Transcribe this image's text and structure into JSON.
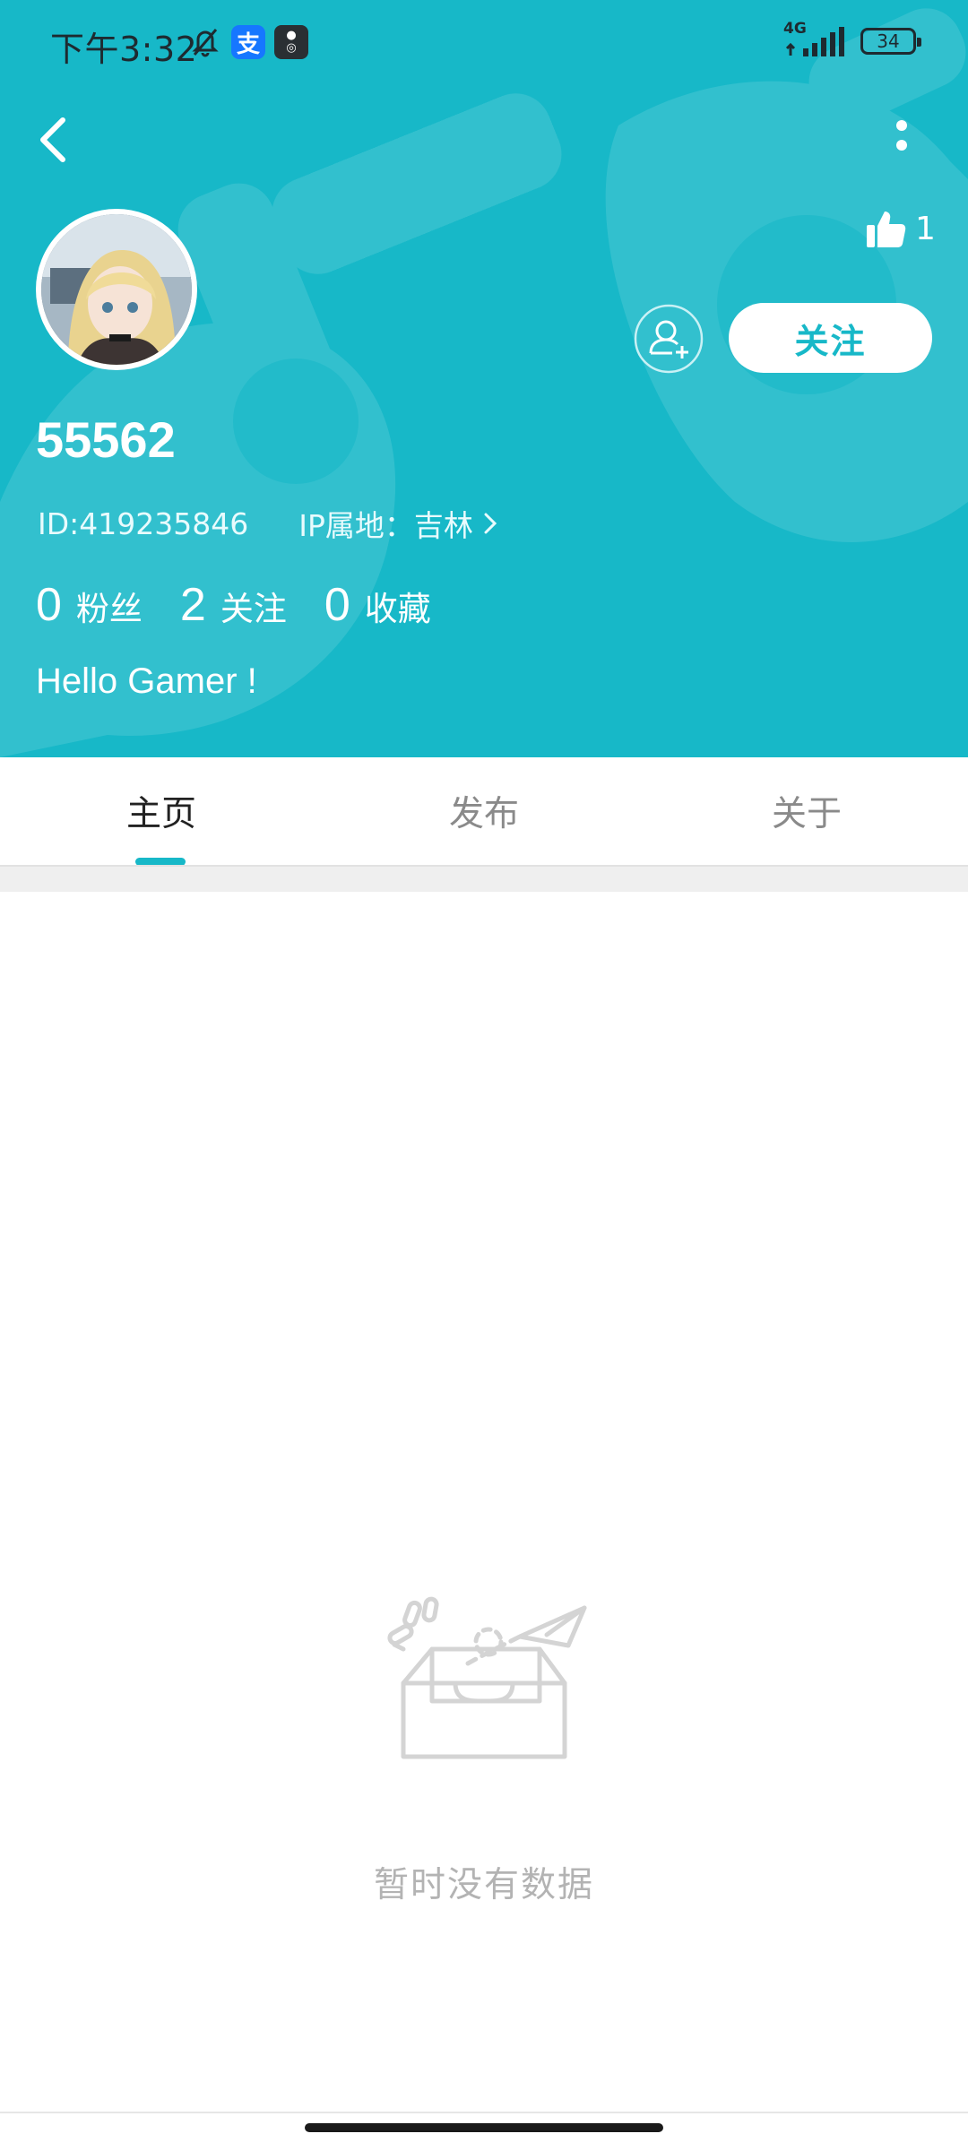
{
  "status_bar": {
    "time": "下午3:32",
    "network": "4G",
    "battery": "34",
    "app_icons": [
      "silent-bell-icon",
      "alipay-icon",
      "app-icon"
    ]
  },
  "profile": {
    "like_count": "1",
    "follow_label": "关注",
    "username": "55562",
    "id_text": "ID:419235846",
    "ip_text": "IP属地：吉林",
    "bio": "Hello Gamer !",
    "stats": [
      {
        "num": "0",
        "label": "粉丝"
      },
      {
        "num": "2",
        "label": "关注"
      },
      {
        "num": "0",
        "label": "收藏"
      }
    ]
  },
  "tabs": [
    {
      "label": "主页",
      "active": true
    },
    {
      "label": "发布",
      "active": false
    },
    {
      "label": "关于",
      "active": false
    }
  ],
  "empty_state": {
    "text": "暂时没有数据"
  },
  "colors": {
    "accent": "#17b8c8",
    "muted_text": "#b3b3b3"
  }
}
